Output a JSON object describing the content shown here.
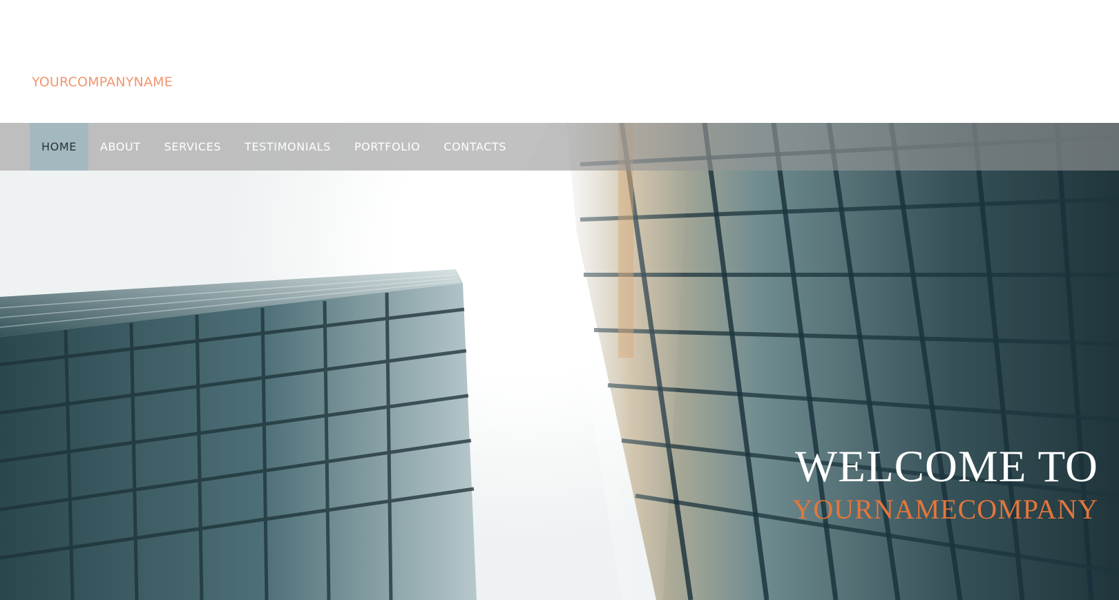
{
  "header": {
    "logo_text": "YOURCOMPANYNAME"
  },
  "nav": {
    "items": [
      {
        "label": "HOME",
        "active": true
      },
      {
        "label": "ABOUT",
        "active": false
      },
      {
        "label": "SERVICES",
        "active": false
      },
      {
        "label": "TESTIMONIALS",
        "active": false
      },
      {
        "label": "PORTFOLIO",
        "active": false
      },
      {
        "label": "CONTACTS",
        "active": false
      }
    ]
  },
  "hero": {
    "headline": "WELCOME TO",
    "subheadline": "YOURNAMECOMPANY"
  },
  "colors": {
    "logo": "#ef9670",
    "accent": "#e5763c",
    "nav_active_bg": "#a4b9bf",
    "building": "#3c5a62"
  }
}
